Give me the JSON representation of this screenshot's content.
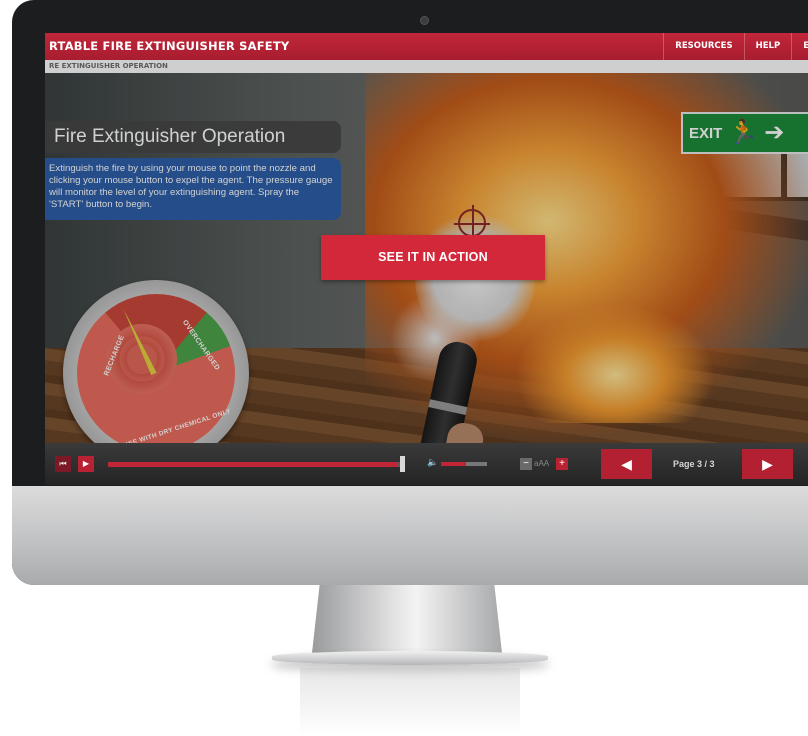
{
  "app": {
    "title": "RTABLE FIRE EXTINGUISHER SAFETY",
    "nav": [
      "RESOURCES",
      "HELP",
      "E"
    ]
  },
  "breadcrumb": "RE EXTINGUISHER OPERATION",
  "lesson": {
    "title": "Fire Extinguisher Operation",
    "instructions": "Extinguish the fire by using your mouse to point the nozzle and clicking your mouse button to expel the agent. The pressure gauge will monitor the level of your extinguishing agent. Spray the 'START' button to begin."
  },
  "scene": {
    "exit_sign": "EXIT",
    "exit_icon": "running-man-icon",
    "exit_arrow": "right-arrow-icon"
  },
  "gauge": {
    "label_left": "RECHARGE",
    "label_right": "OVERCHARGED",
    "label_bottom": "USE WITH DRY CHEMICAL ONLY",
    "needle_fraction": 0.18
  },
  "cta": {
    "label": "SEE IT IN ACTION"
  },
  "controls": {
    "rewind_icon": "rewind-icon",
    "play_icon": "play-icon",
    "progress_fraction": 0.98,
    "volume_fraction": 0.55,
    "text_size_label": "aAA",
    "prev_icon": "left-arrow-icon",
    "next_icon": "right-arrow-icon",
    "page_label": "Page 3 / 3"
  },
  "colors": {
    "brand_red": "#c3263a",
    "instruction_blue": "#2e5fa8",
    "exit_green": "#1e8b3a"
  }
}
